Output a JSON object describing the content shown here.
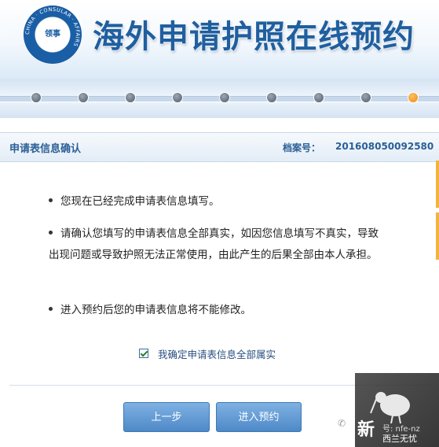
{
  "header": {
    "title": "海外申请护照在线预约",
    "logo_ring_text": "CHINA · CONSULAR · AFFAIRS",
    "logo_center_text": "领事"
  },
  "progress": {
    "step_count": 9,
    "active_step": 9,
    "active_color": "#e88a12"
  },
  "panel": {
    "title": "申请表信息确认",
    "file_label": "档案号：",
    "file_number": "201608050092580",
    "bullets": [
      "您现在已经完成申请表信息填写。",
      "请确认您填写的申请表信息全部真实，如因您信息填写不真实，导致出现问题或导致护照无法正常使用，由此产生的后果全部由本人承担。",
      "进入预约后您的申请表信息将不能修改。"
    ],
    "confirm_label": "我确定申请表信息全部属实",
    "confirm_checked": true
  },
  "buttons": {
    "prev": "上一步",
    "next": "进入预约"
  },
  "watermark": {
    "big": "新",
    "handle": "号: nfe-nz",
    "sub": "西兰无忧"
  },
  "colors": {
    "accent": "#1f5f9f",
    "button": "#5e95d0"
  }
}
